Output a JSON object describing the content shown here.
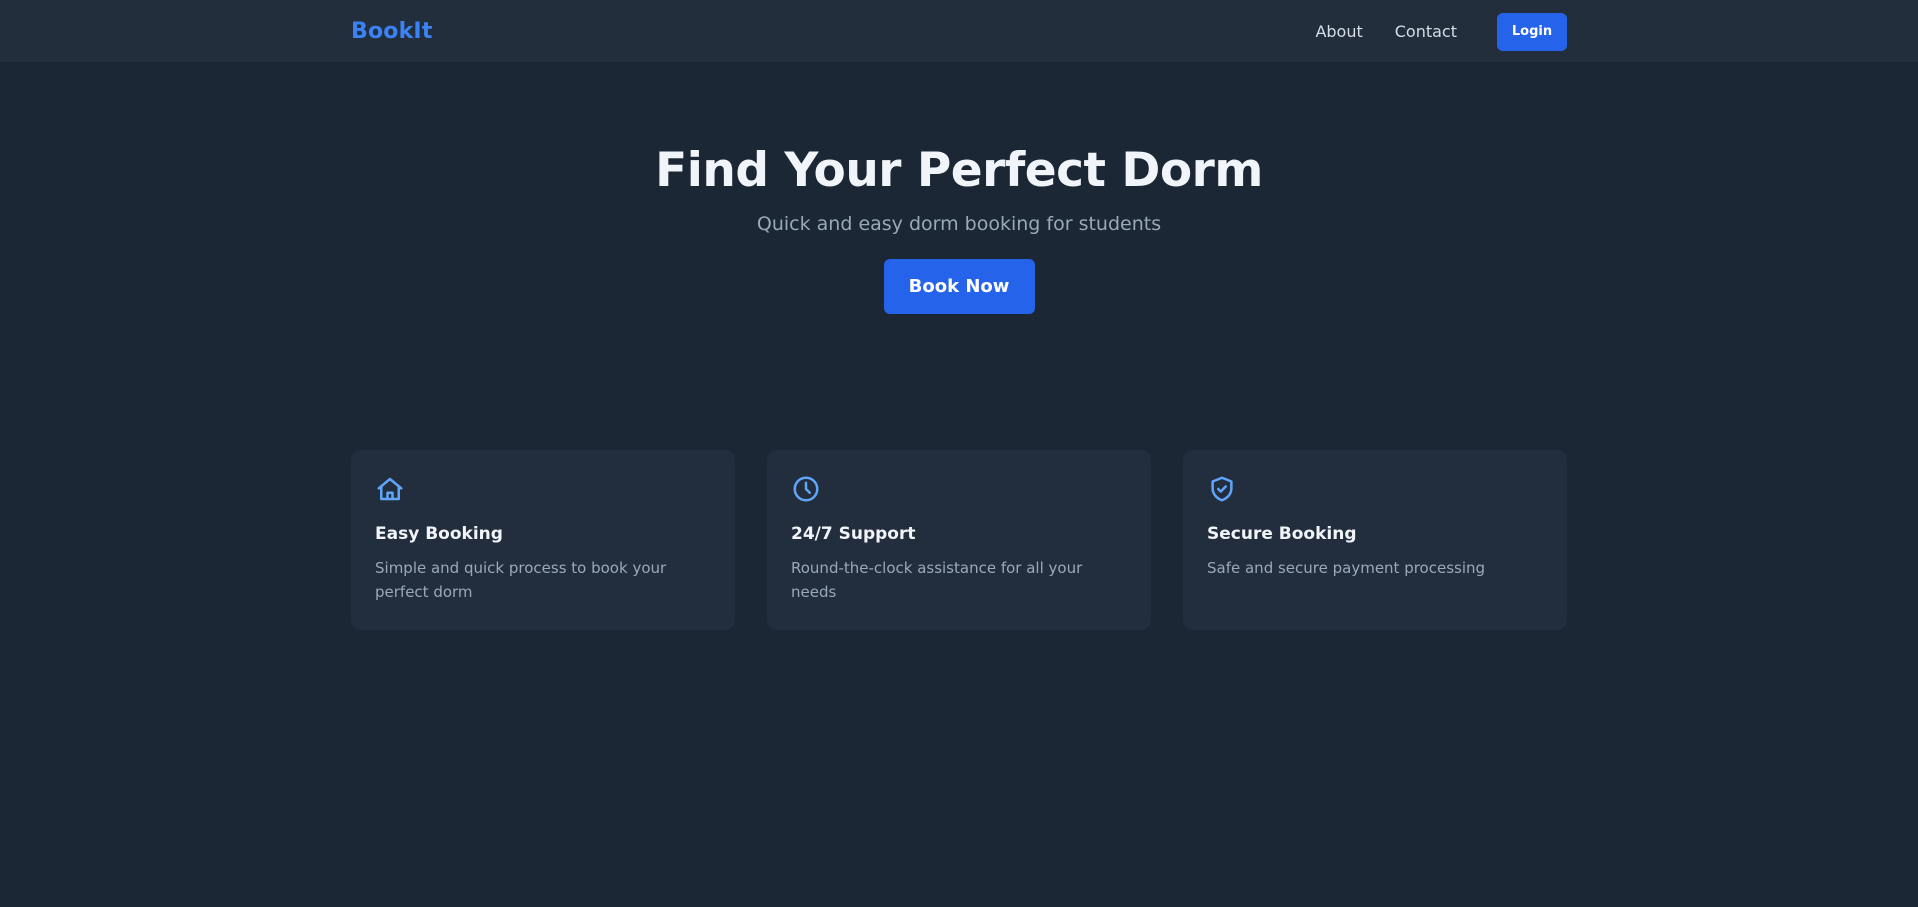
{
  "navbar": {
    "brand": "BookIt",
    "links": [
      "About",
      "Contact"
    ],
    "login_label": "Login"
  },
  "hero": {
    "title": "Find Your Perfect Dorm",
    "subtitle": "Quick and easy dorm booking for students",
    "cta_label": "Book Now"
  },
  "features": [
    {
      "icon": "home-icon",
      "title": "Easy Booking",
      "text": "Simple and quick process to book your perfect dorm"
    },
    {
      "icon": "clock-icon",
      "title": "24/7 Support",
      "text": "Round-the-clock assistance for all your needs"
    },
    {
      "icon": "shield-check-icon",
      "title": "Secure Booking",
      "text": "Safe and secure payment processing"
    }
  ],
  "colors": {
    "accent": "#2563eb",
    "brand": "#3b82f6",
    "background": "#1b2735",
    "card": "#222e3d"
  }
}
